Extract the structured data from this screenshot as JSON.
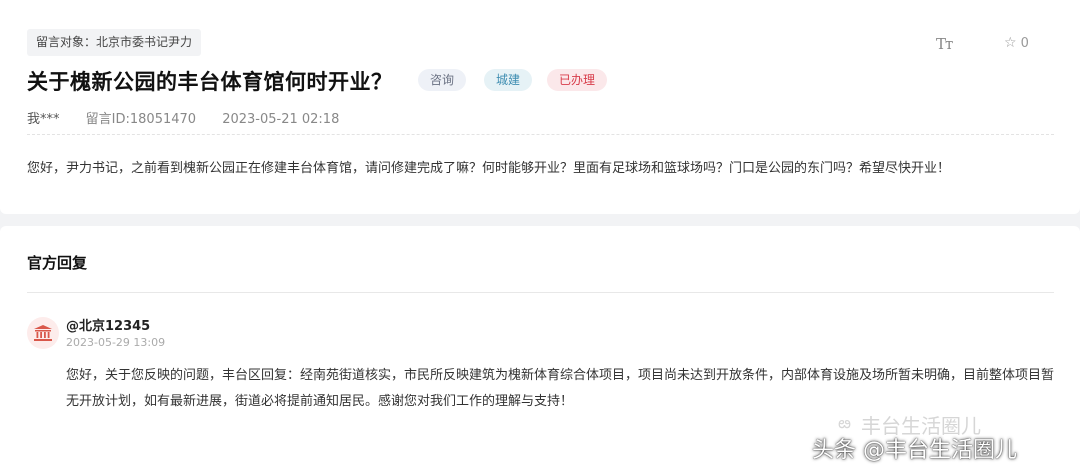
{
  "question": {
    "target_label": "留言对象：北京市委书记尹力",
    "font_tool": "Tт",
    "favorite_count": "0",
    "title": "关于槐新公园的丰台体育馆何时开业？",
    "badges": [
      "咨询",
      "城建",
      "已办理"
    ],
    "author": "我***",
    "message_id": "留言ID:18051470",
    "timestamp": "2023-05-21 02:18",
    "body": "您好，尹力书记，之前看到槐新公园正在修建丰台体育馆，请问修建完成了嘛？何时能够开业？里面有足球场和篮球场吗？门口是公园的东门吗？希望尽快开业！"
  },
  "reply": {
    "heading": "官方回复",
    "responder": "@北京12345",
    "time": "2023-05-29 13:09",
    "body": "您好，关于您反映的问题，丰台区回复：经南苑街道核实，市民所反映建筑为槐新体育综合体项目，项目尚未达到开放条件，内部体育设施及场所暂未明确，目前整体项目暂无开放计划，如有最新进展，街道必将提前通知居民。感谢您对我们工作的理解与支持！"
  },
  "overlay": {
    "watermark": "丰台生活圈儿",
    "credit": "头条 @丰台生活圈儿"
  },
  "colors": {
    "badge_consult": "#6a7183",
    "badge_urban": "#3e8db1",
    "badge_done": "#d83c4a",
    "avatar_icon": "#d9574a"
  },
  "icons": [
    "font-size-icon",
    "star-icon",
    "government-building-icon",
    "wechat-icon"
  ]
}
